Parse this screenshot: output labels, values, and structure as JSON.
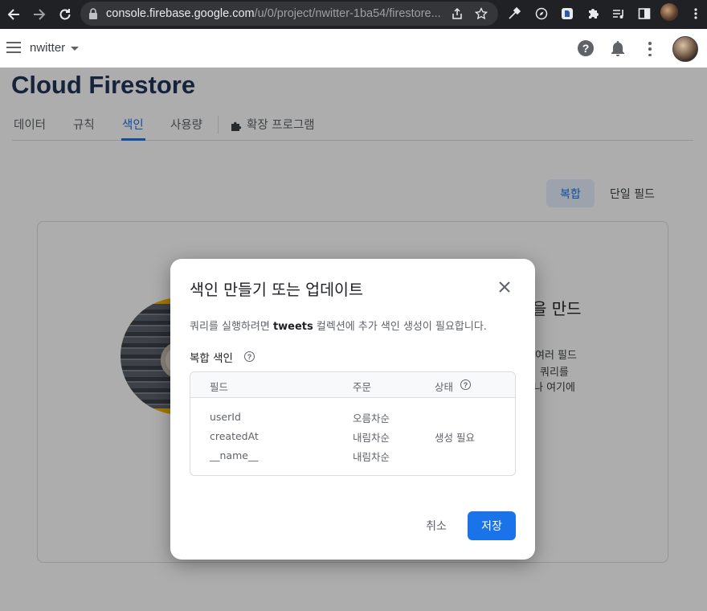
{
  "browser": {
    "url_host": "console.firebase.google.com",
    "url_path": "/u/0/project/nwitter-1ba54/firestore..."
  },
  "app": {
    "project": "nwitter",
    "page_title": "Cloud Firestore"
  },
  "tabs": [
    {
      "label": "데이터"
    },
    {
      "label": "규칙"
    },
    {
      "label": "색인"
    },
    {
      "label": "사용량"
    },
    {
      "label": "확장 프로그램"
    }
  ],
  "toggle": {
    "composite": "복합",
    "single": "단일 필드"
  },
  "card": {
    "heading_fragment": "을 만드",
    "line1": "여러 필드",
    "line2": "쿼리를",
    "line3": "나 여기에"
  },
  "dialog": {
    "title": "색인 만들기 또는 업데이트",
    "desc_before": "쿼리를 실행하려면 ",
    "desc_collection": "tweets",
    "desc_after": " 컬렉션에 추가 색인 생성이 필요합니다.",
    "section_label": "복합 색인",
    "table": {
      "headers": {
        "field": "필드",
        "order": "주문",
        "status": "상태"
      },
      "rows": [
        {
          "field": "userId",
          "order": "오름차순",
          "status": ""
        },
        {
          "field": "createdAt",
          "order": "내림차순",
          "status": "생성 필요"
        },
        {
          "field": "__name__",
          "order": "내림차순",
          "status": ""
        }
      ]
    },
    "cancel_label": "취소",
    "save_label": "저장"
  },
  "colors": {
    "accent": "#1a73e8",
    "title": "#1f3658"
  }
}
